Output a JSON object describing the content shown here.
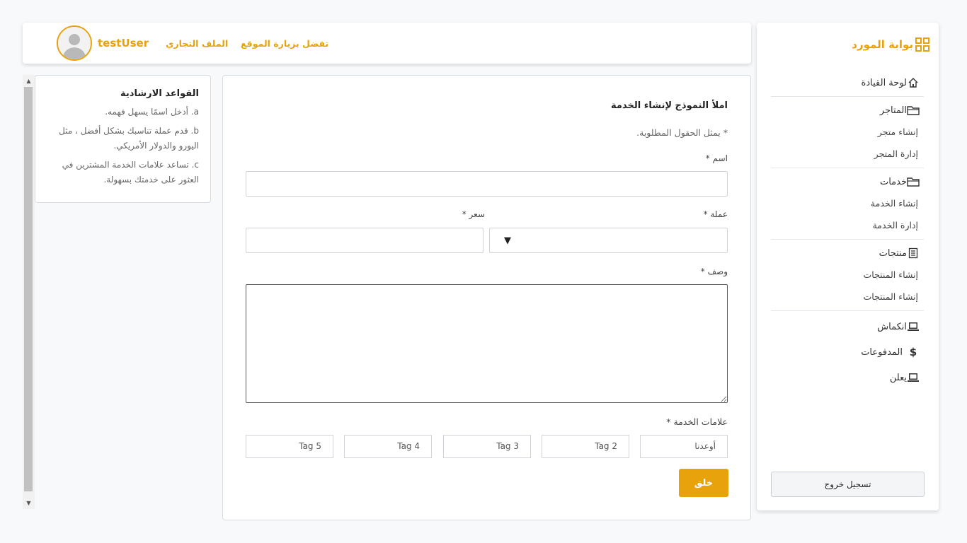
{
  "sidebar": {
    "brand": "بوابة المورد",
    "dashboard": "لوحة القيادة",
    "stores": "المتاجر",
    "create_store": "إنشاء متجر",
    "manage_store": "إدارة المتجر",
    "services": "خدمات",
    "create_service": "إنشاء الخدمة",
    "manage_service": "إدارة الخدمة",
    "products": "منتجات",
    "create_products": "إنشاء المنتجات",
    "create_products_2": "إنشاء المنتجات",
    "recession": "انكماش",
    "payments": "المدفوعات",
    "advertise": "يعلن",
    "logout": "تسجيل خروج"
  },
  "header": {
    "username": "testUser",
    "business_profile": "الملف التجاري",
    "visit_site": "تفضل بزيارة الموقع"
  },
  "guide": {
    "title": "القواعد الارشادية",
    "items": [
      "a. أدخل اسمًا يسهل فهمه.",
      "b. قدم عملة تناسبك بشكل أفضل ، مثل اليورو والدولار الأمريكي.",
      "c. تساعد علامات الخدمة المشترين في العثور على خدمتك بسهولة."
    ]
  },
  "form": {
    "title": "املأ النموذج لإنشاء الخدمة",
    "note": "* يمثل الحقول المطلوبة.",
    "name_label": "اسم *",
    "currency_label": "عملة *",
    "price_label": "سعر *",
    "description_label": "وصف *",
    "tags_label": "علامات الخدمة *",
    "currency_arrow": "▼",
    "tags": [
      "أوعدنا",
      "Tag 2",
      "Tag 3",
      "Tag 4",
      "Tag 5"
    ],
    "create_label": "خلق"
  },
  "colors": {
    "accent": "#e8a20c"
  }
}
